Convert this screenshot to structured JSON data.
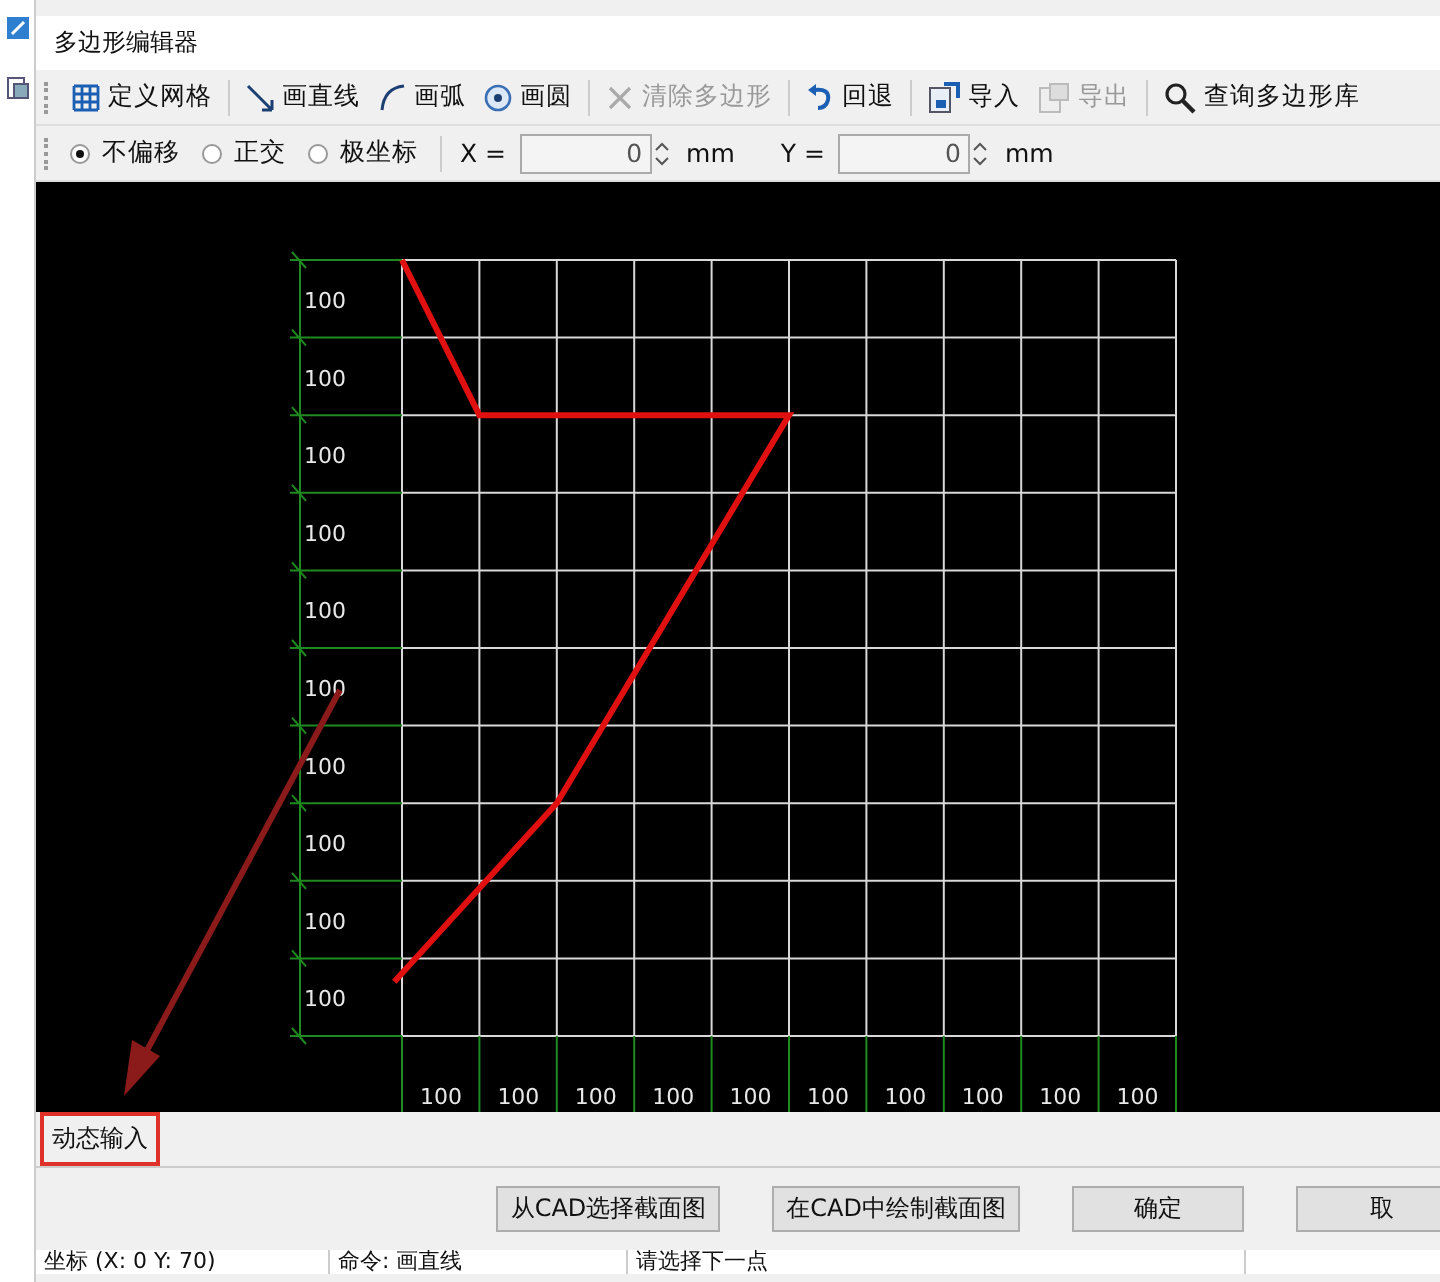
{
  "window": {
    "title": "多边形编辑器"
  },
  "toolbar": [
    {
      "label": "定义网格",
      "disabled": false,
      "separator_after": true
    },
    {
      "label": "画直线",
      "disabled": false,
      "separator_after": false
    },
    {
      "label": "画弧",
      "disabled": false,
      "separator_after": false
    },
    {
      "label": "画圆",
      "disabled": false,
      "separator_after": true
    },
    {
      "label": "清除多边形",
      "disabled": true,
      "separator_after": true
    },
    {
      "label": "回退",
      "disabled": false,
      "separator_after": true
    },
    {
      "label": "导入",
      "disabled": false,
      "separator_after": false
    },
    {
      "label": "导出",
      "disabled": true,
      "separator_after": true
    },
    {
      "label": "查询多边形库",
      "disabled": false,
      "separator_after": false
    }
  ],
  "offset_modes": [
    {
      "label": "不偏移",
      "selected": true
    },
    {
      "label": "正交",
      "selected": false
    },
    {
      "label": "极坐标",
      "selected": false
    }
  ],
  "coords": [
    {
      "label": "X =",
      "value": "0",
      "unit": "mm"
    },
    {
      "label": "Y =",
      "value": "0",
      "unit": "mm"
    }
  ],
  "canvas": {
    "row_labels": [
      "100",
      "100",
      "100",
      "100",
      "100",
      "100",
      "100",
      "100",
      "100",
      "100"
    ],
    "column_labels": [
      "100",
      "100",
      "100",
      "100",
      "100",
      "100",
      "100",
      "100",
      "100",
      "100"
    ]
  },
  "dynamic_input": {
    "label": "动态输入",
    "highlighted": true
  },
  "buttons": [
    "从CAD选择截面图",
    "在CAD中绘制截面图",
    "确定",
    "取"
  ],
  "status_bar": [
    "坐标 (X: 0 Y: 70)",
    "命令: 画直线",
    "请选择下一点"
  ]
}
